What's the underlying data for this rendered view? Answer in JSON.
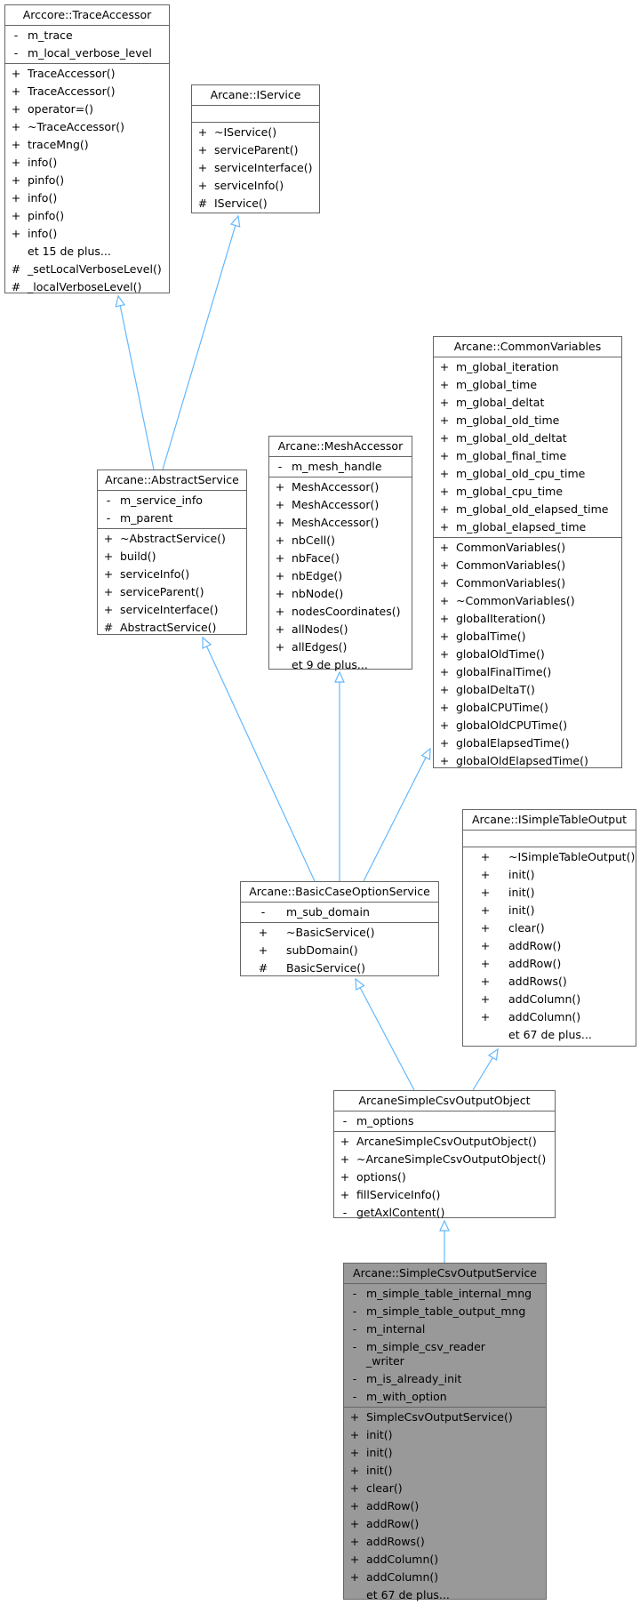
{
  "diagram": {
    "edge_color": "#63b8ff",
    "classes": [
      {
        "id": "trace_accessor",
        "title": "Arccore::TraceAccessor",
        "attributes": [
          {
            "vis": "-",
            "name": "m_trace"
          },
          {
            "vis": "-",
            "name": "m_local_verbose_level"
          }
        ],
        "methods": [
          {
            "vis": "+",
            "name": "TraceAccessor()"
          },
          {
            "vis": "+",
            "name": "TraceAccessor()"
          },
          {
            "vis": "+",
            "name": "operator=()"
          },
          {
            "vis": "+",
            "name": "~TraceAccessor()"
          },
          {
            "vis": "+",
            "name": "traceMng()"
          },
          {
            "vis": "+",
            "name": "info()"
          },
          {
            "vis": "+",
            "name": "pinfo()"
          },
          {
            "vis": "+",
            "name": "info()"
          },
          {
            "vis": "+",
            "name": "pinfo()"
          },
          {
            "vis": "+",
            "name": "info()"
          },
          {
            "vis": "",
            "name": "et 15 de plus..."
          },
          {
            "vis": "#",
            "name": "_setLocalVerboseLevel()"
          },
          {
            "vis": "#",
            "name": "_localVerboseLevel()"
          }
        ]
      },
      {
        "id": "iservice",
        "title": "Arcane::IService",
        "attributes": [],
        "methods": [
          {
            "vis": "+",
            "name": "~IService()"
          },
          {
            "vis": "+",
            "name": "serviceParent()"
          },
          {
            "vis": "+",
            "name": "serviceInterface()"
          },
          {
            "vis": "+",
            "name": "serviceInfo()"
          },
          {
            "vis": "#",
            "name": "IService()"
          }
        ]
      },
      {
        "id": "abstract_service",
        "title": "Arcane::AbstractService",
        "attributes": [
          {
            "vis": "-",
            "name": "m_service_info"
          },
          {
            "vis": "-",
            "name": "m_parent"
          }
        ],
        "methods": [
          {
            "vis": "+",
            "name": "~AbstractService()"
          },
          {
            "vis": "+",
            "name": "build()"
          },
          {
            "vis": "+",
            "name": "serviceInfo()"
          },
          {
            "vis": "+",
            "name": "serviceParent()"
          },
          {
            "vis": "+",
            "name": "serviceInterface()"
          },
          {
            "vis": "#",
            "name": "AbstractService()"
          }
        ]
      },
      {
        "id": "mesh_accessor",
        "title": "Arcane::MeshAccessor",
        "attributes": [
          {
            "vis": "-",
            "name": "m_mesh_handle"
          }
        ],
        "methods": [
          {
            "vis": "+",
            "name": "MeshAccessor()"
          },
          {
            "vis": "+",
            "name": "MeshAccessor()"
          },
          {
            "vis": "+",
            "name": "MeshAccessor()"
          },
          {
            "vis": "+",
            "name": "nbCell()"
          },
          {
            "vis": "+",
            "name": "nbFace()"
          },
          {
            "vis": "+",
            "name": "nbEdge()"
          },
          {
            "vis": "+",
            "name": "nbNode()"
          },
          {
            "vis": "+",
            "name": "nodesCoordinates()"
          },
          {
            "vis": "+",
            "name": "allNodes()"
          },
          {
            "vis": "+",
            "name": "allEdges()"
          },
          {
            "vis": "",
            "name": "et 9 de plus..."
          }
        ]
      },
      {
        "id": "common_variables",
        "title": "Arcane::CommonVariables",
        "attributes": [
          {
            "vis": "+",
            "name": "m_global_iteration"
          },
          {
            "vis": "+",
            "name": "m_global_time"
          },
          {
            "vis": "+",
            "name": "m_global_deltat"
          },
          {
            "vis": "+",
            "name": "m_global_old_time"
          },
          {
            "vis": "+",
            "name": "m_global_old_deltat"
          },
          {
            "vis": "+",
            "name": "m_global_final_time"
          },
          {
            "vis": "+",
            "name": "m_global_old_cpu_time"
          },
          {
            "vis": "+",
            "name": "m_global_cpu_time"
          },
          {
            "vis": "+",
            "name": "m_global_old_elapsed_time"
          },
          {
            "vis": "+",
            "name": "m_global_elapsed_time"
          }
        ],
        "methods": [
          {
            "vis": "+",
            "name": "CommonVariables()"
          },
          {
            "vis": "+",
            "name": "CommonVariables()"
          },
          {
            "vis": "+",
            "name": "CommonVariables()"
          },
          {
            "vis": "+",
            "name": "~CommonVariables()"
          },
          {
            "vis": "+",
            "name": "globalIteration()"
          },
          {
            "vis": "+",
            "name": "globalTime()"
          },
          {
            "vis": "+",
            "name": "globalOldTime()"
          },
          {
            "vis": "+",
            "name": "globalFinalTime()"
          },
          {
            "vis": "+",
            "name": "globalDeltaT()"
          },
          {
            "vis": "+",
            "name": "globalCPUTime()"
          },
          {
            "vis": "+",
            "name": "globalOldCPUTime()"
          },
          {
            "vis": "+",
            "name": "globalElapsedTime()"
          },
          {
            "vis": "+",
            "name": "globalOldElapsedTime()"
          }
        ]
      },
      {
        "id": "isimple_table_output",
        "title": "Arcane::ISimpleTableOutput",
        "attributes": [],
        "methods": [
          {
            "vis": "+",
            "name": "~ISimpleTableOutput()"
          },
          {
            "vis": "+",
            "name": "init()"
          },
          {
            "vis": "+",
            "name": "init()"
          },
          {
            "vis": "+",
            "name": "init()"
          },
          {
            "vis": "+",
            "name": "clear()"
          },
          {
            "vis": "+",
            "name": "addRow()"
          },
          {
            "vis": "+",
            "name": "addRow()"
          },
          {
            "vis": "+",
            "name": "addRows()"
          },
          {
            "vis": "+",
            "name": "addColumn()"
          },
          {
            "vis": "+",
            "name": "addColumn()"
          },
          {
            "vis": "",
            "name": "et 67 de plus..."
          }
        ]
      },
      {
        "id": "basic_case_option_service",
        "title": "Arcane::BasicCaseOptionService",
        "attributes": [
          {
            "vis": "-",
            "name": "m_sub_domain"
          }
        ],
        "methods": [
          {
            "vis": "+",
            "name": "~BasicService()"
          },
          {
            "vis": "+",
            "name": "subDomain()"
          },
          {
            "vis": "#",
            "name": "BasicService()"
          }
        ]
      },
      {
        "id": "arcane_simple_csv_output_object",
        "title": "ArcaneSimpleCsvOutputObject",
        "attributes": [
          {
            "vis": "-",
            "name": "m_options"
          }
        ],
        "methods": [
          {
            "vis": "+",
            "name": "ArcaneSimpleCsvOutputObject()"
          },
          {
            "vis": "+",
            "name": "~ArcaneSimpleCsvOutputObject()"
          },
          {
            "vis": "+",
            "name": "options()"
          },
          {
            "vis": "+",
            "name": "fillServiceInfo()"
          },
          {
            "vis": "-",
            "name": "getAxlContent()"
          }
        ]
      },
      {
        "id": "simple_csv_output_service",
        "title": "Arcane::SimpleCsvOutputService",
        "highlighted": true,
        "attributes": [
          {
            "vis": "-",
            "name": "m_simple_table_internal_mng"
          },
          {
            "vis": "-",
            "name": "m_simple_table_output_mng"
          },
          {
            "vis": "-",
            "name": "m_internal"
          },
          {
            "vis": "-",
            "name": "m_simple_csv_reader\n_writer"
          },
          {
            "vis": "-",
            "name": "m_is_already_init"
          },
          {
            "vis": "-",
            "name": "m_with_option"
          }
        ],
        "methods": [
          {
            "vis": "+",
            "name": "SimpleCsvOutputService()"
          },
          {
            "vis": "+",
            "name": "init()"
          },
          {
            "vis": "+",
            "name": "init()"
          },
          {
            "vis": "+",
            "name": "init()"
          },
          {
            "vis": "+",
            "name": "clear()"
          },
          {
            "vis": "+",
            "name": "addRow()"
          },
          {
            "vis": "+",
            "name": "addRow()"
          },
          {
            "vis": "+",
            "name": "addRows()"
          },
          {
            "vis": "+",
            "name": "addColumn()"
          },
          {
            "vis": "+",
            "name": "addColumn()"
          },
          {
            "vis": "",
            "name": "et 67 de plus..."
          }
        ]
      }
    ],
    "inheritance": [
      {
        "from": "abstract_service",
        "to": "trace_accessor"
      },
      {
        "from": "abstract_service",
        "to": "iservice"
      },
      {
        "from": "basic_case_option_service",
        "to": "abstract_service"
      },
      {
        "from": "basic_case_option_service",
        "to": "mesh_accessor"
      },
      {
        "from": "basic_case_option_service",
        "to": "common_variables"
      },
      {
        "from": "arcane_simple_csv_output_object",
        "to": "basic_case_option_service"
      },
      {
        "from": "arcane_simple_csv_output_object",
        "to": "isimple_table_output"
      },
      {
        "from": "simple_csv_output_service",
        "to": "arcane_simple_csv_output_object"
      }
    ]
  }
}
